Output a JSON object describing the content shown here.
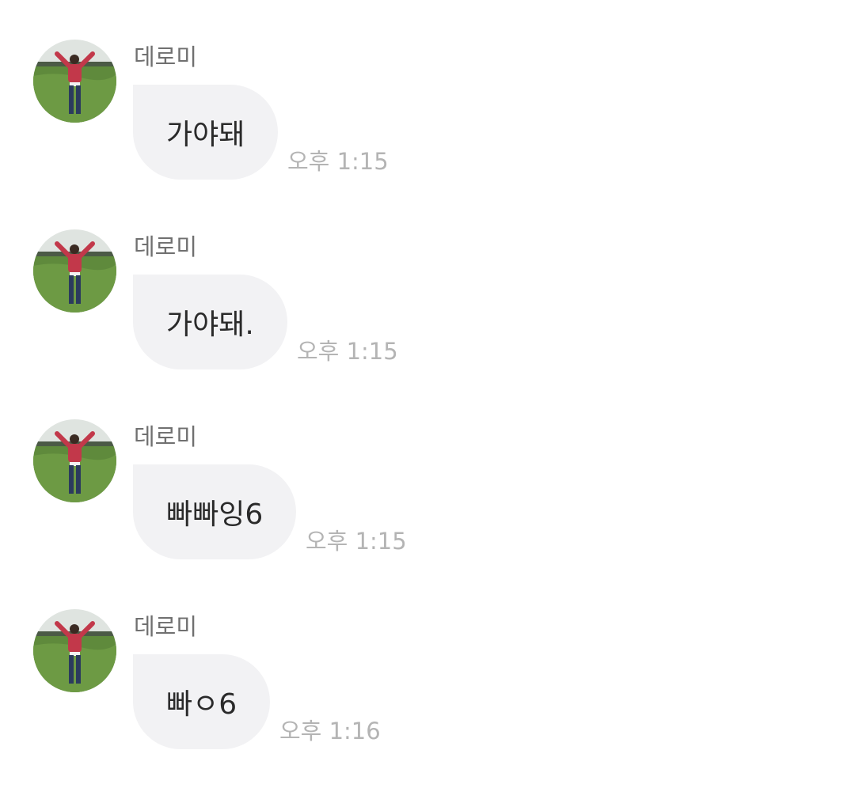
{
  "messages": [
    {
      "sender": "데로미",
      "text": "가야돼",
      "time": "오후 1:15"
    },
    {
      "sender": "데로미",
      "text": "가야돼.",
      "time": "오후 1:15"
    },
    {
      "sender": "데로미",
      "text": "빠빠잉6",
      "time": "오후 1:15"
    },
    {
      "sender": "데로미",
      "text": "빠ㅇ6",
      "time": "오후 1:16"
    }
  ],
  "colors": {
    "bubble": "#f2f2f4",
    "sender": "#707070",
    "time": "#b4b4b4",
    "message_text": "#2a2a2a"
  },
  "icons": {
    "avatar": "profile-photo-person-in-field"
  }
}
